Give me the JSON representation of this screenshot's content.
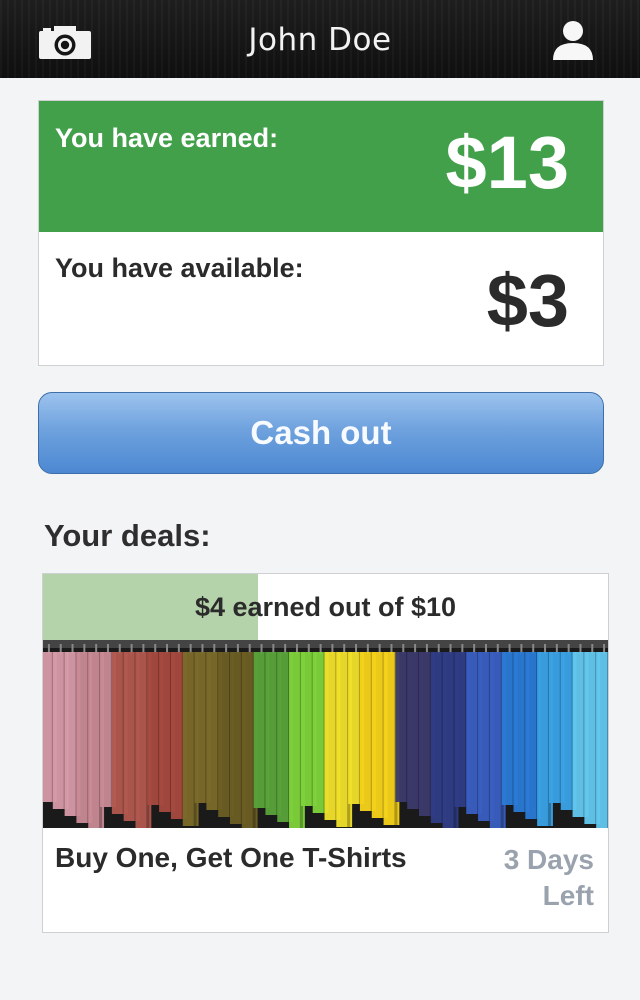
{
  "header": {
    "title": "John Doe",
    "left_icon": "camera-icon",
    "right_icon": "user-icon"
  },
  "earnings": {
    "earned_label": "You have earned:",
    "earned_amount": "$13",
    "available_label": "You have available:",
    "available_amount": "$3"
  },
  "cashout": {
    "label": "Cash out"
  },
  "deals": {
    "heading": "Your deals:",
    "items": [
      {
        "progress_text": "$4 earned out of $10",
        "progress_fraction": 0.38,
        "image": "colorful-tshirts-on-rack",
        "title": "Buy One, Get One T-Shirts",
        "days_left_line1": "3 Days",
        "days_left_line2": "Left"
      }
    ]
  },
  "colors": {
    "earned_bg": "#42a04b",
    "progress_fill": "#b5d3aa",
    "button_blue": "#6fa2de",
    "days_left": "#9aa3ad"
  }
}
